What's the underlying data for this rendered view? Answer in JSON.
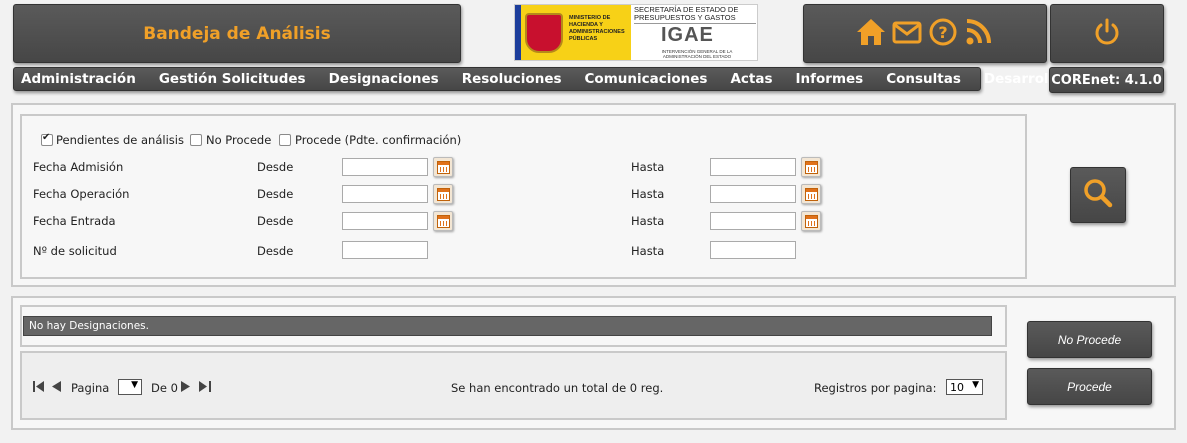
{
  "header": {
    "title": "Bandeja de Análisis",
    "logo": {
      "ministry": "MINISTERIO DE HACIENDA Y ADMINISTRACIONES PÚBLICAS",
      "secretary": "SECRETARÍA DE ESTADO DE PRESUPUESTOS Y GASTOS",
      "igae": "IGAE",
      "igae_subtitle": "INTERVENCIÓN GENERAL DE LA ADMINISTRACIÓN DEL ESTADO"
    },
    "icons": [
      "home-icon",
      "mail-icon",
      "help-icon",
      "rss-icon",
      "power-icon"
    ]
  },
  "menu": {
    "items": [
      "Administración",
      "Gestión Solicitudes",
      "Designaciones",
      "Resoluciones",
      "Comunicaciones",
      "Actas",
      "Informes",
      "Consultas",
      "Desarrollo"
    ],
    "version": "COREnet: 4.1.0"
  },
  "filters": {
    "checkboxes": [
      {
        "label": "Pendientes de análisis",
        "checked": true
      },
      {
        "label": "No Procede",
        "checked": false
      },
      {
        "label": "Procede (Pdte. confirmación)",
        "checked": false
      }
    ],
    "rows": [
      {
        "label": "Fecha Admisión",
        "from_label": "Desde",
        "from_value": "",
        "to_label": "Hasta",
        "to_value": ""
      },
      {
        "label": "Fecha Operación",
        "from_label": "Desde",
        "from_value": "",
        "to_label": "Hasta",
        "to_value": ""
      },
      {
        "label": "Fecha Entrada",
        "from_label": "Desde",
        "from_value": "",
        "to_label": "Hasta",
        "to_value": ""
      },
      {
        "label": "Nº de solicitud",
        "from_label": "Desde",
        "from_value": "",
        "to_label": "Hasta",
        "to_value": ""
      }
    ]
  },
  "results": {
    "empty_message": "No hay Designaciones.",
    "pager": {
      "page_label": "Pagina",
      "page_value": "",
      "of_label": "De 0",
      "total_text": "Se han encontrado un total de 0 reg.",
      "per_page_label": "Registros por pagina:",
      "per_page_value": "10"
    }
  },
  "actions": {
    "no_procede": "No Procede",
    "procede": "Procede"
  },
  "colors": {
    "accent": "#f0a028",
    "dark_bar": "#4e4e4e"
  }
}
